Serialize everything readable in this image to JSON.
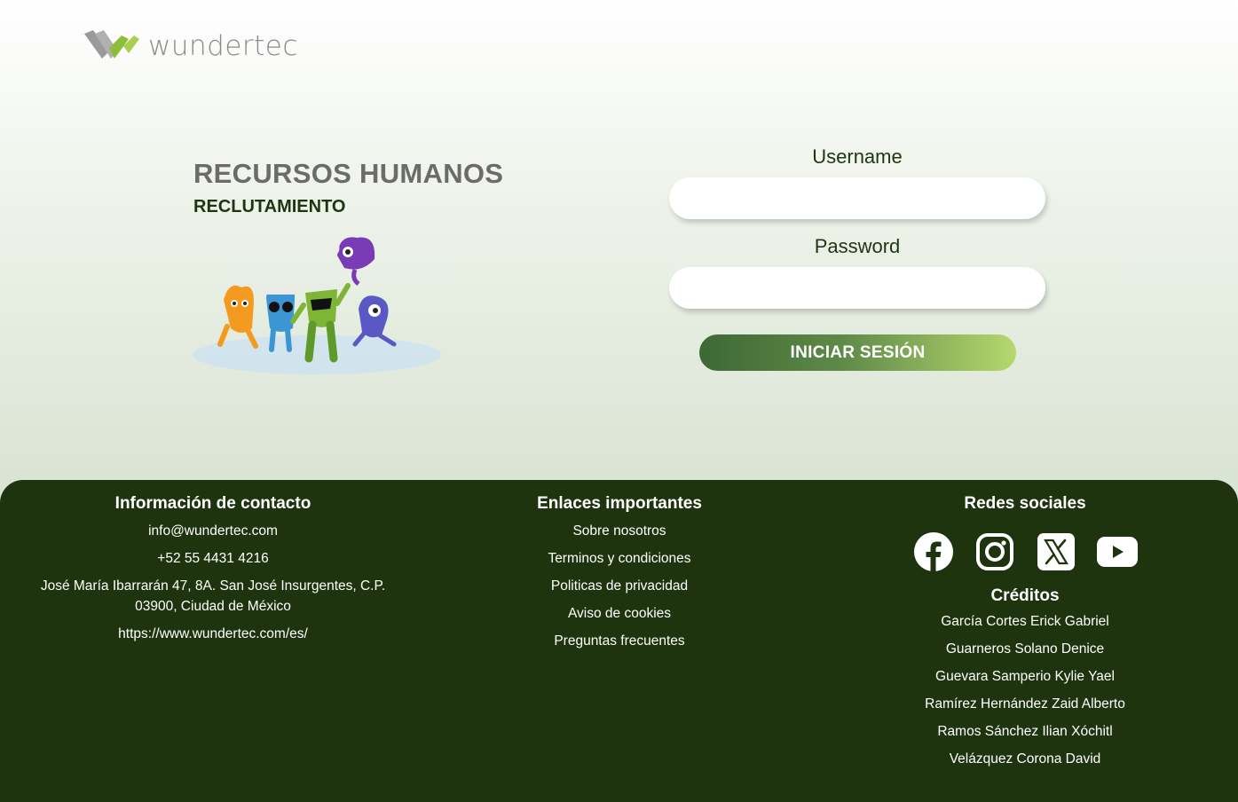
{
  "brand": {
    "name": "wundertec"
  },
  "hero": {
    "title": "RECURSOS HUMANOS",
    "subtitle": "RECLUTAMIENTO"
  },
  "login": {
    "username_label": "Username",
    "username_value": "",
    "password_label": "Password",
    "password_value": "",
    "submit_label": "INICIAR SESIÓN"
  },
  "footer": {
    "contact": {
      "heading": "Información de contacto",
      "email": "info@wundertec.com",
      "phone": "+52 55 4431 4216",
      "address": "José María Ibarrarán 47, 8A. San José Insurgentes, C.P. 03900, Ciudad de México",
      "website": "https://www.wundertec.com/es/"
    },
    "links": {
      "heading": "Enlaces importantes",
      "items": [
        "Sobre nosotros",
        "Terminos y condiciones",
        "Politicas de privacidad",
        "Aviso de cookies",
        "Preguntas frecuentes"
      ]
    },
    "social": {
      "heading": "Redes sociales",
      "icons": [
        "facebook-icon",
        "instagram-icon",
        "x-icon",
        "youtube-icon"
      ]
    },
    "credits": {
      "heading": "Créditos",
      "names": [
        "García Cortes Erick Gabriel",
        "Guarneros Solano Denice",
        "Guevara Samperio Kylie Yael",
        "Ramírez Hernández Zaid Alberto",
        "Ramos Sánchez Ilian Xóchitl",
        "Velázquez Corona David"
      ]
    }
  },
  "colors": {
    "footer_bg": "#1e340e",
    "accent_dark": "#3d6835",
    "accent_light": "#b6d86e",
    "title_gray": "#6b6b6b"
  }
}
